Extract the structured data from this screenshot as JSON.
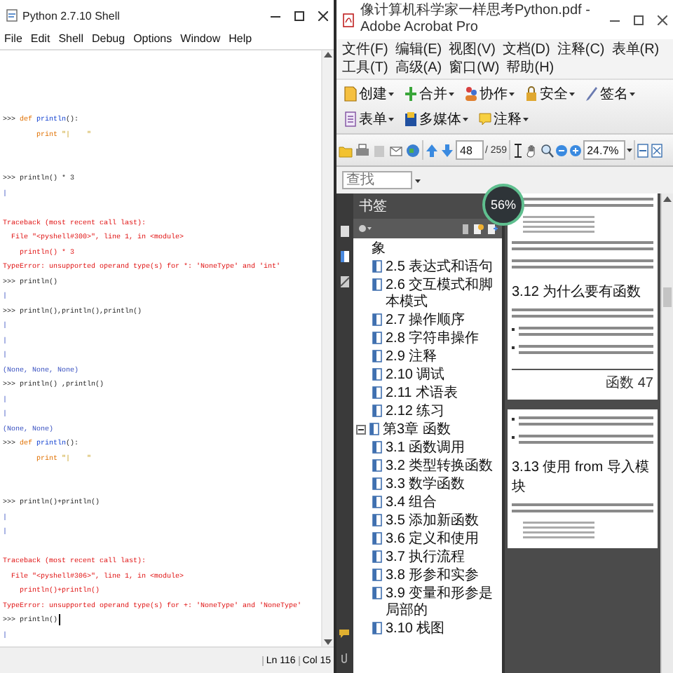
{
  "shell": {
    "title": "Python 2.7.10 Shell",
    "menu": [
      "File",
      "Edit",
      "Shell",
      "Debug",
      "Options",
      "Window",
      "Help"
    ],
    "lines": [
      {
        "kind": "code",
        "cursor": false,
        "parts": [
          {
            "kind": "prompt",
            "text": ">>> "
          },
          {
            "kind": "keyword",
            "text": "def "
          },
          {
            "kind": "name",
            "text": "println"
          },
          {
            "kind": "plain",
            "text": "():"
          }
        ]
      },
      {
        "kind": "body",
        "cursor": false,
        "parts": [
          {
            "kind": "keyword",
            "text": "print "
          },
          {
            "kind": "string",
            "text": "\"|    \""
          }
        ]
      },
      {
        "kind": "blank"
      },
      {
        "kind": "blank"
      },
      {
        "kind": "code",
        "cursor": false,
        "parts": [
          {
            "kind": "prompt",
            "text": ">>> "
          },
          {
            "kind": "plain",
            "text": "println() * 3"
          }
        ]
      },
      {
        "kind": "output",
        "text": "|"
      },
      {
        "kind": "blank"
      },
      {
        "kind": "error",
        "text": "Traceback (most recent call last):"
      },
      {
        "kind": "error",
        "text": "  File \"<pyshell#300>\", line 1, in <module>"
      },
      {
        "kind": "error",
        "text": "    println() * 3"
      },
      {
        "kind": "error",
        "text": "TypeError: unsupported operand type(s) for *: 'NoneType' and 'int'"
      },
      {
        "kind": "code",
        "cursor": false,
        "parts": [
          {
            "kind": "prompt",
            "text": ">>> "
          },
          {
            "kind": "plain",
            "text": "println()"
          }
        ]
      },
      {
        "kind": "output",
        "text": "|"
      },
      {
        "kind": "code",
        "cursor": false,
        "parts": [
          {
            "kind": "prompt",
            "text": ">>> "
          },
          {
            "kind": "plain",
            "text": "println(),println(),println()"
          }
        ]
      },
      {
        "kind": "output",
        "text": "|"
      },
      {
        "kind": "output",
        "text": "|"
      },
      {
        "kind": "output",
        "text": "|"
      },
      {
        "kind": "output",
        "text": "(None, None, None)"
      },
      {
        "kind": "code",
        "cursor": false,
        "parts": [
          {
            "kind": "prompt",
            "text": ">>> "
          },
          {
            "kind": "plain",
            "text": "println() ,println()"
          }
        ]
      },
      {
        "kind": "output",
        "text": "|"
      },
      {
        "kind": "output",
        "text": "|"
      },
      {
        "kind": "output",
        "text": "(None, None)"
      },
      {
        "kind": "code",
        "cursor": false,
        "parts": [
          {
            "kind": "prompt",
            "text": ">>> "
          },
          {
            "kind": "keyword",
            "text": "def "
          },
          {
            "kind": "name",
            "text": "println"
          },
          {
            "kind": "plain",
            "text": "():"
          }
        ]
      },
      {
        "kind": "body",
        "cursor": false,
        "parts": [
          {
            "kind": "keyword",
            "text": "print "
          },
          {
            "kind": "string",
            "text": "\"|    \""
          }
        ]
      },
      {
        "kind": "blank"
      },
      {
        "kind": "blank"
      },
      {
        "kind": "code",
        "cursor": false,
        "parts": [
          {
            "kind": "prompt",
            "text": ">>> "
          },
          {
            "kind": "plain",
            "text": "println()+println()"
          }
        ]
      },
      {
        "kind": "output",
        "text": "|"
      },
      {
        "kind": "output",
        "text": "|"
      },
      {
        "kind": "blank"
      },
      {
        "kind": "error",
        "text": "Traceback (most recent call last):"
      },
      {
        "kind": "error",
        "text": "  File \"<pyshell#306>\", line 1, in <module>"
      },
      {
        "kind": "error",
        "text": "    println()+println()"
      },
      {
        "kind": "error",
        "text": "TypeError: unsupported operand type(s) for +: 'NoneType' and 'NoneType'"
      },
      {
        "kind": "code",
        "cursor": true,
        "parts": [
          {
            "kind": "prompt",
            "text": ">>> "
          },
          {
            "kind": "plain",
            "text": "println()"
          }
        ]
      },
      {
        "kind": "output",
        "text": "|"
      }
    ],
    "status": [
      "Ln 116",
      "Col 15"
    ]
  },
  "acrobat": {
    "title": "像计算机科学家一样思考Python.pdf - Adobe Acrobat Pro",
    "menu": [
      "文件(F)",
      "编辑(E)",
      "视图(V)",
      "文档(D)",
      "注释(C)",
      "表单(R)",
      "工具(T)",
      "高级(A)",
      "窗口(W)",
      "帮助(H)"
    ],
    "tasks": [
      {
        "label": "创建",
        "kind": "create"
      },
      {
        "label": "合并",
        "kind": "combine"
      },
      {
        "label": "协作",
        "kind": "collaborate"
      },
      {
        "label": "安全",
        "kind": "secure"
      },
      {
        "label": "签名",
        "kind": "sign"
      },
      {
        "label": "表单",
        "kind": "forms"
      },
      {
        "label": "多媒体",
        "kind": "multimedia"
      },
      {
        "label": "注释",
        "kind": "comment"
      }
    ],
    "page_field": {
      "value": "48"
    },
    "page_count": "/ 259",
    "zoom_field": {
      "value": "24.7%"
    },
    "search_field": {
      "placeholder": "查找"
    },
    "monitor": {
      "reading": "56%"
    },
    "bookmarks": {
      "title": "书签",
      "loose_items": [
        {
          "label": "象"
        },
        {
          "label": "2.5 表达式和语句"
        },
        {
          "label": "2.6 交互模式和脚本模式"
        },
        {
          "label": "2.7 操作顺序"
        },
        {
          "label": "2.8 字符串操作"
        },
        {
          "label": "2.9 注释"
        },
        {
          "label": "2.10 调试"
        },
        {
          "label": "2.11 术语表"
        },
        {
          "label": "2.12 练习"
        }
      ],
      "nodes": [
        {
          "label": "第3章 函数",
          "expanded": true,
          "children": [
            {
              "label": "3.1 函数调用"
            },
            {
              "label": "3.2 类型转换函数"
            },
            {
              "label": "3.3 数学函数"
            },
            {
              "label": "3.4 组合"
            },
            {
              "label": "3.5 添加新函数"
            },
            {
              "label": "3.6 定义和使用"
            },
            {
              "label": "3.7 执行流程"
            },
            {
              "label": "3.8 形参和实参"
            },
            {
              "label": "3.9 变量和形参是局部的"
            },
            {
              "label": "3.10 栈图"
            }
          ]
        }
      ]
    },
    "pages": [
      {
        "blocks": [
          {
            "kind": "text"
          },
          {
            "kind": "code"
          },
          {
            "kind": "text"
          },
          {
            "kind": "text"
          },
          {
            "kind": "heading",
            "text": "3.12  为什么要有函数"
          },
          {
            "kind": "text"
          },
          {
            "kind": "bullet"
          },
          {
            "kind": "bullet"
          },
          {
            "kind": "footer",
            "text": "函数  47"
          }
        ]
      },
      {
        "blocks": [
          {
            "kind": "bullet"
          },
          {
            "kind": "bullet"
          },
          {
            "kind": "heading",
            "text": "3.13  使用 from 导入模块"
          },
          {
            "kind": "text"
          },
          {
            "kind": "code"
          }
        ]
      }
    ]
  }
}
